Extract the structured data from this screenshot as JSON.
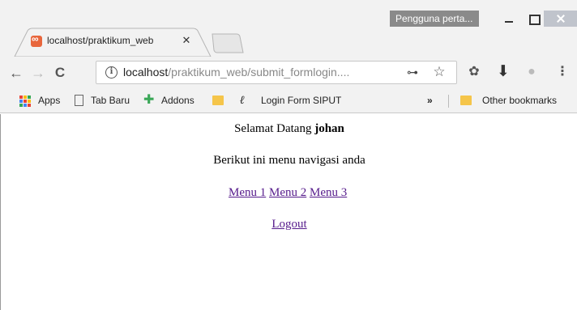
{
  "window": {
    "profile_label": "Pengguna perta..."
  },
  "tab": {
    "title": "localhost/praktikum_web"
  },
  "address_bar": {
    "host": "localhost",
    "path": "/praktikum_web/submit_formlogin...."
  },
  "bookmarks": [
    {
      "label": "Apps"
    },
    {
      "label": "Tab Baru"
    },
    {
      "label": "Addons"
    },
    {
      "label": ""
    },
    {
      "label": "Login Form SIPUT"
    },
    {
      "label": "»"
    },
    {
      "label": "Other bookmarks"
    }
  ],
  "page": {
    "welcome_prefix": "Selamat Datang",
    "username": "johan",
    "intro": "Berikut ini menu navigasi anda",
    "menu_links": [
      "Menu 1",
      "Menu 2",
      "Menu 3"
    ],
    "logout": "Logout"
  },
  "colors": {
    "link": "#551a8b",
    "chrome_bg": "#f2f2f2",
    "favicon": "#e8663c",
    "folder": "#f5c54a",
    "addons_icon": "#3aa757"
  },
  "icons": {
    "back": "arrow-left-icon",
    "forward": "arrow-right-icon",
    "reload": "reload-icon",
    "info": "info-icon",
    "key": "key-icon",
    "star": "star-icon",
    "menu": "kebab-menu-icon"
  }
}
